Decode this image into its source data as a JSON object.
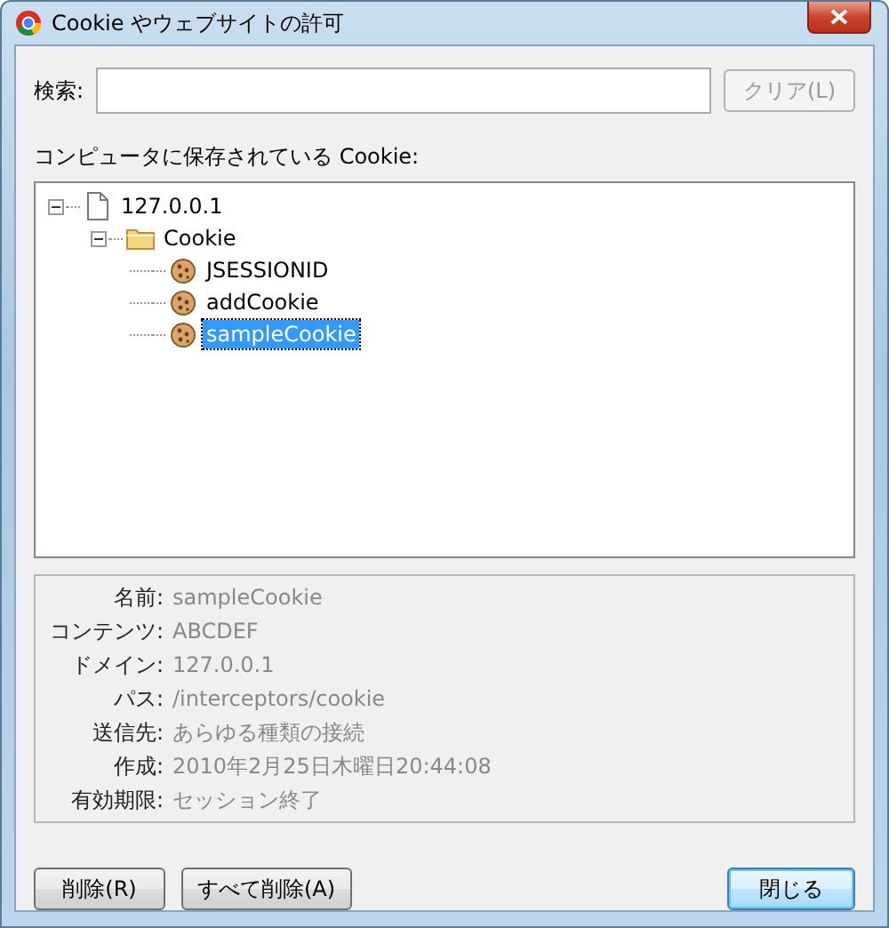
{
  "window": {
    "title": "Cookie やウェブサイトの許可"
  },
  "search": {
    "label": "検索:",
    "clear_button": {
      "label": "クリア(L)",
      "disabled": true
    }
  },
  "tree_label": "コンピュータに保存されている Cookie:",
  "tree": [
    {
      "label": "127.0.0.1",
      "kind": "site",
      "expanded": true,
      "selected": false,
      "children": [
        {
          "label": "Cookie",
          "kind": "folder",
          "expanded": true,
          "selected": false,
          "children": [
            {
              "label": "JSESSIONID",
              "kind": "cookie",
              "selected": false
            },
            {
              "label": "addCookie",
              "kind": "cookie",
              "selected": false
            },
            {
              "label": "sampleCookie",
              "kind": "cookie",
              "selected": true
            }
          ]
        }
      ]
    }
  ],
  "details": [
    {
      "label": "名前:",
      "value": "sampleCookie"
    },
    {
      "label": "コンテンツ:",
      "value": "ABCDEF"
    },
    {
      "label": "ドメイン:",
      "value": "127.0.0.1"
    },
    {
      "label": "パス:",
      "value": "/interceptors/cookie"
    },
    {
      "label": "送信先:",
      "value": "あらゆる種類の接続"
    },
    {
      "label": "作成:",
      "value": "2010年2月25日木曜日20:44:08"
    },
    {
      "label": "有効期限:",
      "value": "セッション終了"
    }
  ],
  "buttons": [
    {
      "label": "削除(R)",
      "kind": "normal"
    },
    {
      "label": "すべて削除(A)",
      "kind": "normal"
    },
    {
      "label": "閉じる",
      "kind": "default"
    }
  ]
}
